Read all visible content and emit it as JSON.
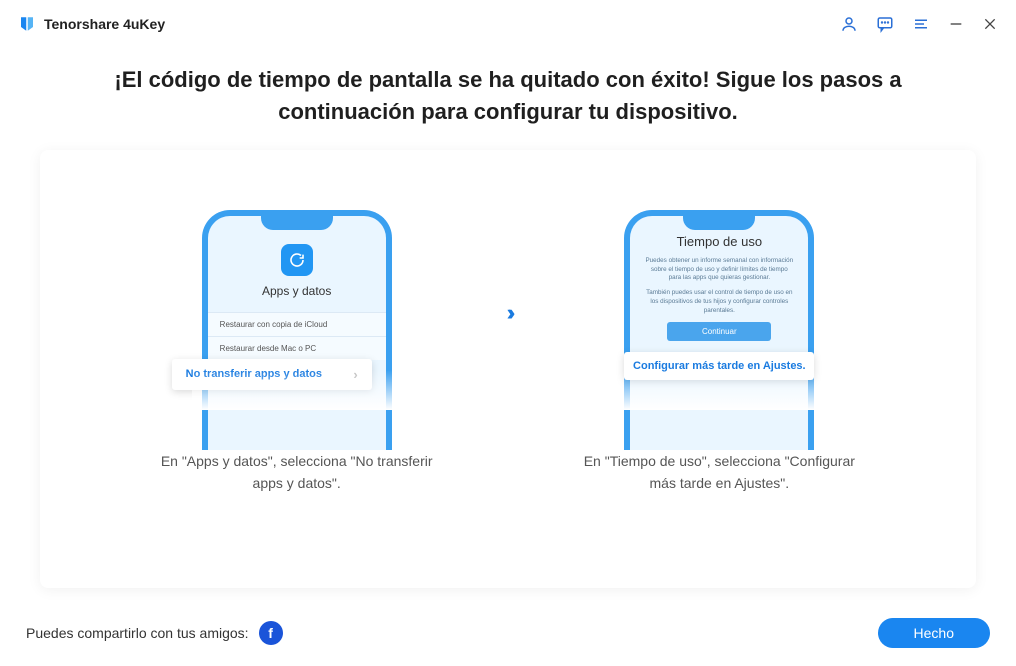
{
  "app": {
    "title": "Tenorshare 4uKey"
  },
  "heading": "¡El código de tiempo de pantalla se ha quitado con éxito! Sigue los pasos a continuación para configurar tu dispositivo.",
  "step1": {
    "phone_title": "Apps y datos",
    "option1": "Restaurar con copia de iCloud",
    "option2": "Restaurar desde Mac o PC",
    "callout": "No transferir apps y datos",
    "caption": "En \"Apps y datos\", selecciona \"No transferir apps y datos\"."
  },
  "step2": {
    "phone_title": "Tiempo de uso",
    "text1": "Puedes obtener un informe semanal con información sobre el tiempo de uso y definir límites de tiempo para las apps que quieras gestionar.",
    "text2": "También puedes usar el control de tiempo de uso en los dispositivos de tus hijos y configurar controles parentales.",
    "continue": "Continuar",
    "callout": "Configurar más tarde en Ajustes.",
    "caption": "En \"Tiempo de uso\", selecciona \"Configurar más tarde en Ajustes\"."
  },
  "footer": {
    "share_label": "Puedes compartirlo con tus amigos:",
    "done": "Hecho"
  }
}
